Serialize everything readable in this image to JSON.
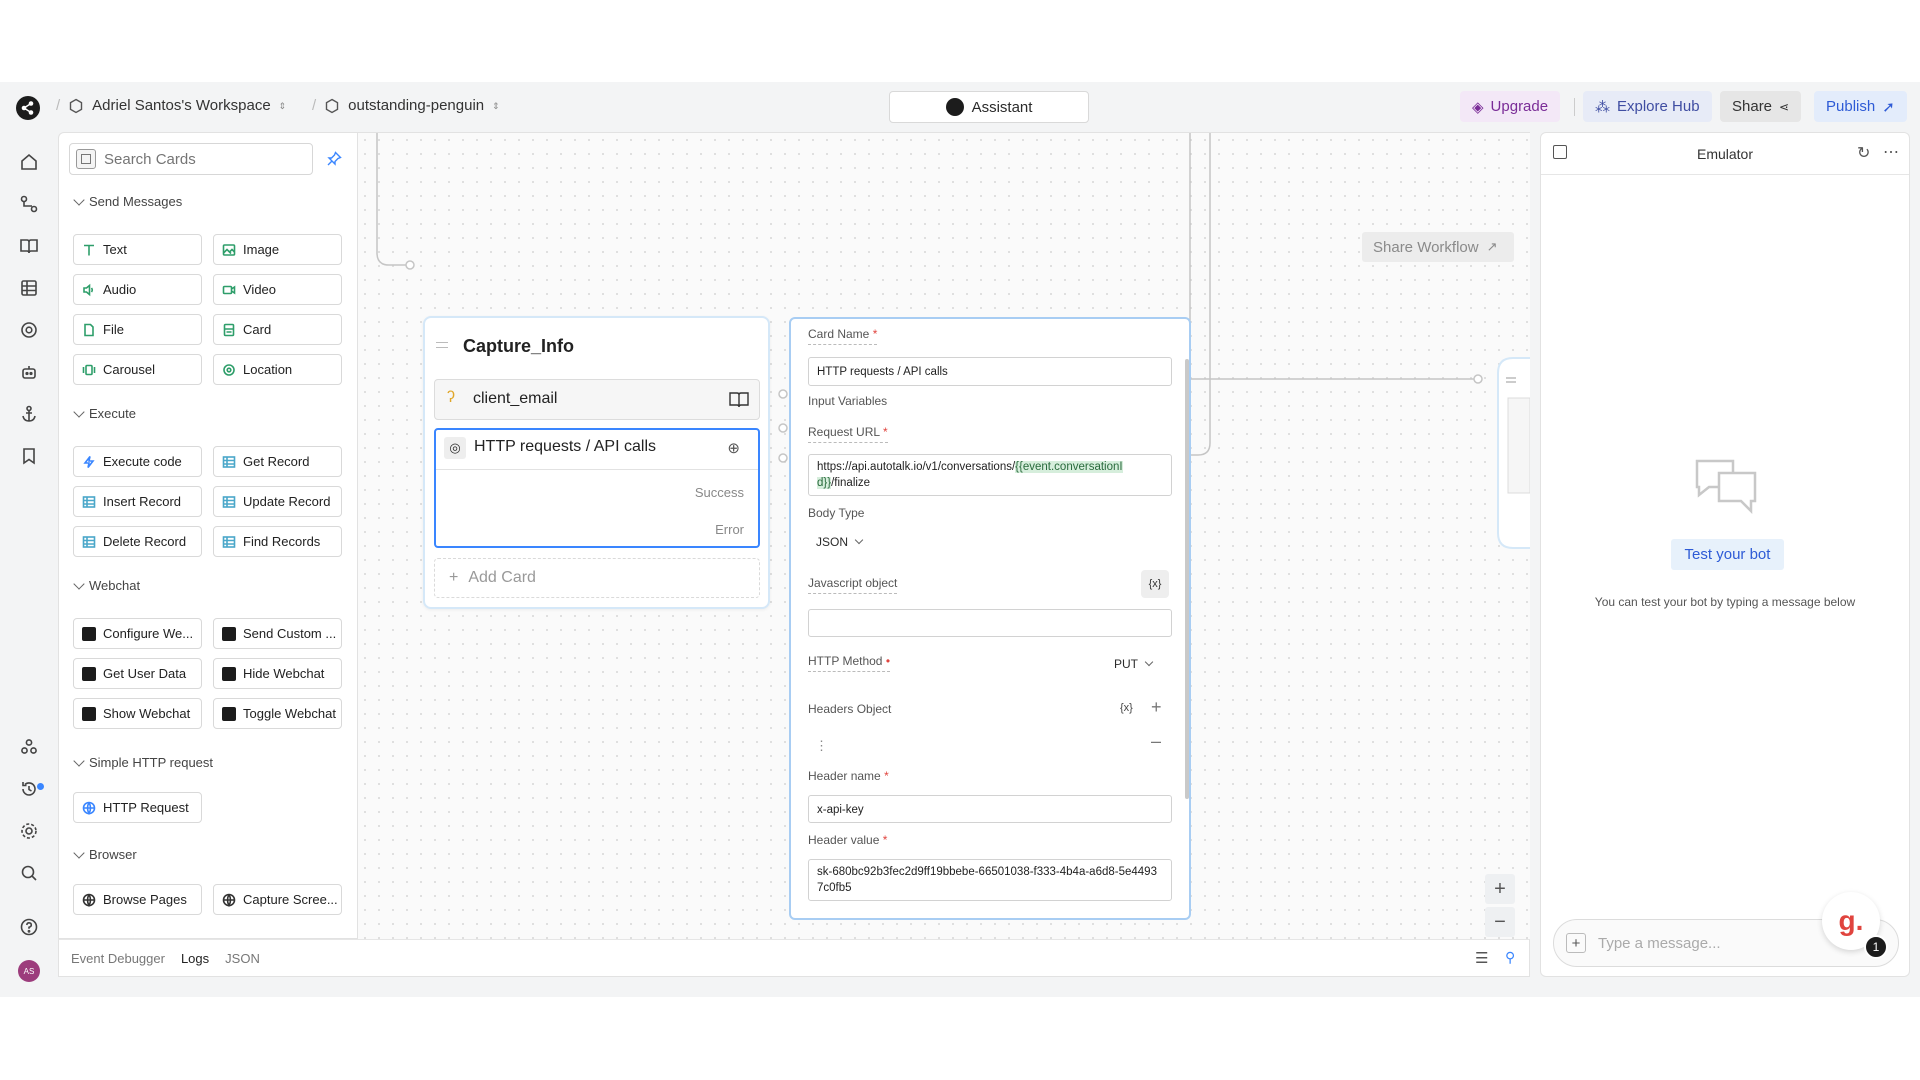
{
  "topbar": {
    "workspace": "Adriel Santos's Workspace",
    "project": "outstanding-penguin",
    "assistant_label": "Assistant",
    "upgrade_label": "Upgrade",
    "explore_label": "Explore Hub",
    "share_label": "Share",
    "publish_label": "Publish"
  },
  "sidebar": {
    "avatar_initials": "AS"
  },
  "cards_panel": {
    "search_placeholder": "Search Cards",
    "sections": {
      "send_messages": "Send Messages",
      "execute": "Execute",
      "webchat": "Webchat",
      "simple_http": "Simple HTTP request",
      "browser": "Browser"
    },
    "send_messages": [
      "Text",
      "Image",
      "Audio",
      "Video",
      "File",
      "Card",
      "Carousel",
      "Location"
    ],
    "execute": [
      "Execute code",
      "Get Record",
      "Insert Record",
      "Update Record",
      "Delete Record",
      "Find Records"
    ],
    "webchat": [
      "Configure We...",
      "Send Custom ...",
      "Get User Data",
      "Hide Webchat",
      "Show Webchat",
      "Toggle Webchat"
    ],
    "simple_http": [
      "HTTP Request"
    ],
    "browser": [
      "Browse Pages",
      "Capture Scree..."
    ]
  },
  "bottombar": {
    "tabs": [
      "Event Debugger",
      "Logs",
      "JSON"
    ]
  },
  "canvas": {
    "share_workflow": "Share Workflow",
    "node": {
      "title": "Capture_Info",
      "card1": "client_email",
      "card2": "HTTP requests / API calls",
      "success": "Success",
      "error": "Error",
      "add_card": "Add Card"
    }
  },
  "detail": {
    "card_name_label": "Card Name",
    "card_name_value": "HTTP requests / API calls",
    "input_variables_label": "Input Variables",
    "request_url_label": "Request URL",
    "request_url_prefix": "https://api.autotalk.io/v1/conversations/",
    "request_url_var_a": "{{event.conversationI",
    "request_url_var_b": "d}}",
    "request_url_suffix": "/finalize",
    "body_type_label": "Body Type",
    "body_type_value": "JSON",
    "js_object_label": "Javascript object",
    "var_button": "{x}",
    "http_method_label": "HTTP Method",
    "http_method_value": "PUT",
    "headers_label": "Headers Object",
    "header_name_label": "Header name",
    "header_name_value": "x-api-key",
    "header_value_label": "Header value",
    "header_value_value": "sk-680bc92b3fec2d9ff19bbebe-66501038-f333-4b4a-a6d8-5e44937c0fb5"
  },
  "emulator": {
    "title": "Emulator",
    "test_button": "Test your bot",
    "test_subtitle": "You can test your bot by typing a message below",
    "message_placeholder": "Type a message...",
    "badge_letter": "g.",
    "badge_count": "1"
  }
}
